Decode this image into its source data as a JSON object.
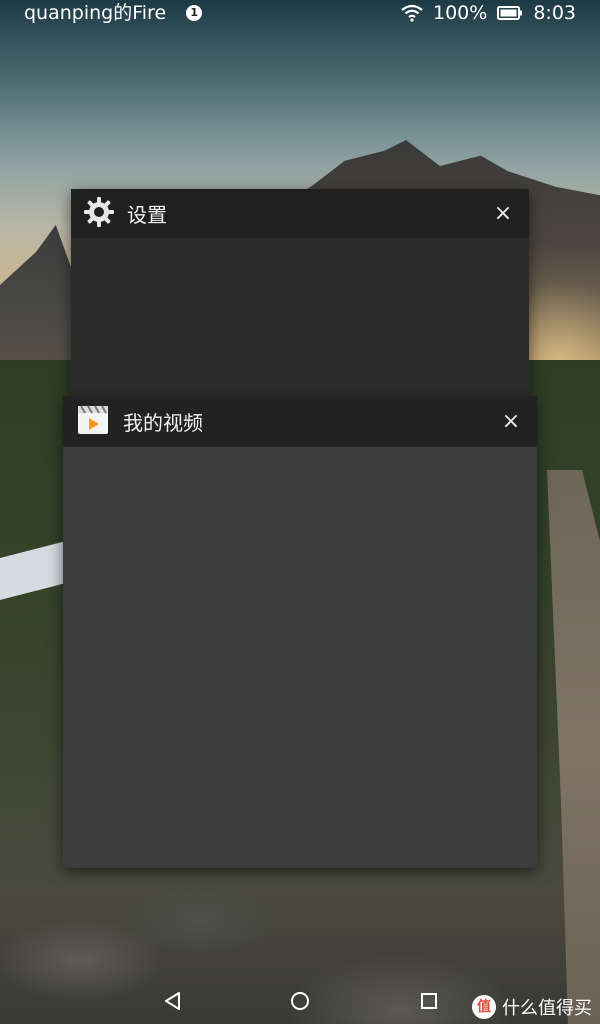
{
  "status_bar": {
    "device_name": "quanping的Fire",
    "notification_count": "1",
    "battery": "100%",
    "time": "8:03"
  },
  "recent_apps": [
    {
      "title": "设置",
      "icon": "gear-icon",
      "close": "×"
    },
    {
      "title": "我的视频",
      "icon": "video-app-icon",
      "close": "×"
    }
  ],
  "nav_bar": {
    "back_icon": "back-triangle-icon",
    "home_icon": "home-circle-icon",
    "recent_icon": "recent-square-icon"
  },
  "watermark": {
    "logo_text": "值",
    "text": "什么值得买"
  },
  "colors": {
    "card_header": "#202020",
    "card_body_settings": "#2c2c2c",
    "card_body_video": "#3c3c3c",
    "video_icon_accent": "#f39c12"
  }
}
